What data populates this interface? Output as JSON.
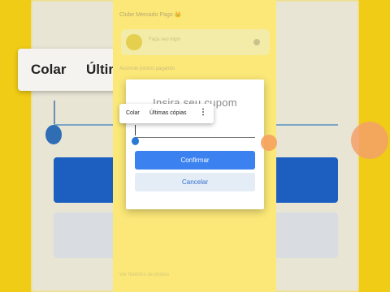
{
  "background": {
    "paste_label": "Colar",
    "recent_label": "Últim"
  },
  "app": {
    "title": "Clube Mercado Pago 👑",
    "card_text": "Faça seu login",
    "subtitle": "Acumule pontos pagando",
    "footer": "Ver histórico de pontos"
  },
  "dialog": {
    "title": "Insira seu cupom",
    "input_value": "",
    "confirm_label": "Confirmar",
    "cancel_label": "Cancelar"
  },
  "paste_popup": {
    "paste_label": "Colar",
    "recent_label": "Últimas cópias",
    "more_icon": "⋮"
  },
  "colors": {
    "accent": "#3b82f0",
    "background_yellow": "#f7d51c",
    "touch_indicator": "#f5a25d"
  }
}
